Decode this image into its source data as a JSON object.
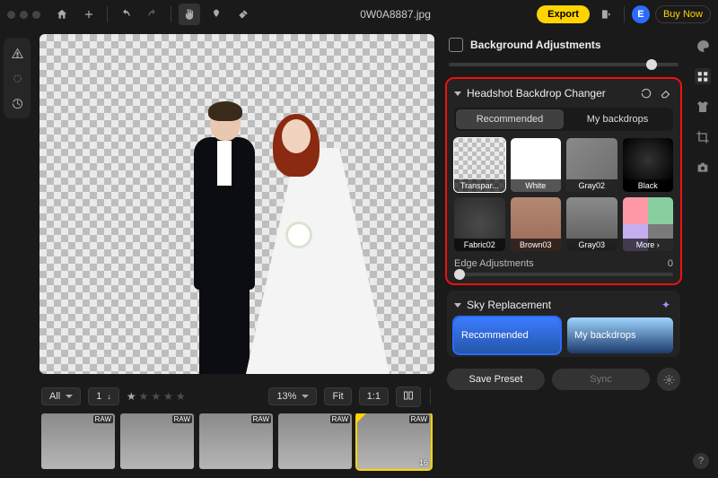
{
  "topbar": {
    "filename": "0W0A8887.jpg",
    "export": "Export",
    "avatar": "E",
    "buy_now": "Buy Now"
  },
  "filmstrip": {
    "filter": "All",
    "count": "1",
    "zoom": "13%",
    "fit": "Fit",
    "one_to_one": "1:1",
    "raw_badge": "RAW",
    "selected_index": "16"
  },
  "panel": {
    "bg_title": "Background Adjustments",
    "backdrop": {
      "title": "Headshot Backdrop Changer",
      "tab_recommended": "Recommended",
      "tab_my": "My backdrops",
      "items": {
        "transparent": "Transpar...",
        "white": "White",
        "gray02": "Gray02",
        "black": "Black",
        "fabric02": "Fabric02",
        "brown03": "Brown03",
        "gray03": "Gray03",
        "more": "More"
      },
      "edge_label": "Edge Adjustments",
      "edge_value": "0"
    },
    "sky": {
      "title": "Sky Replacement",
      "recommended": "Recommended",
      "my": "My backdrops"
    },
    "save_preset": "Save Preset",
    "sync": "Sync"
  }
}
